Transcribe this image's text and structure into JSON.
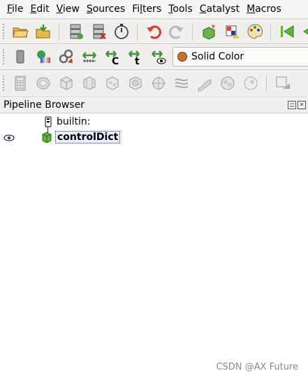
{
  "menubar": {
    "items": [
      {
        "mnemonic": "F",
        "rest": "ile"
      },
      {
        "mnemonic": "E",
        "rest": "dit"
      },
      {
        "mnemonic": "V",
        "rest": "iew"
      },
      {
        "mnemonic": "S",
        "rest": "ources"
      },
      {
        "mnemonic": "",
        "rest": "Fi",
        "mnemonic_mid": "l",
        "rest2": "ters"
      },
      {
        "mnemonic": "T",
        "rest": "ools"
      },
      {
        "mnemonic": "C",
        "rest": "atalyst"
      },
      {
        "mnemonic": "M",
        "rest": "acros"
      }
    ]
  },
  "toolbar2": {
    "coloring_value": "Solid Color",
    "coloring_swatch": "#c9742a"
  },
  "pipeline_browser": {
    "title": "Pipeline Browser",
    "root_label": "builtin:",
    "child_label": "controlDict"
  },
  "watermark": "CSDN @AX Future"
}
